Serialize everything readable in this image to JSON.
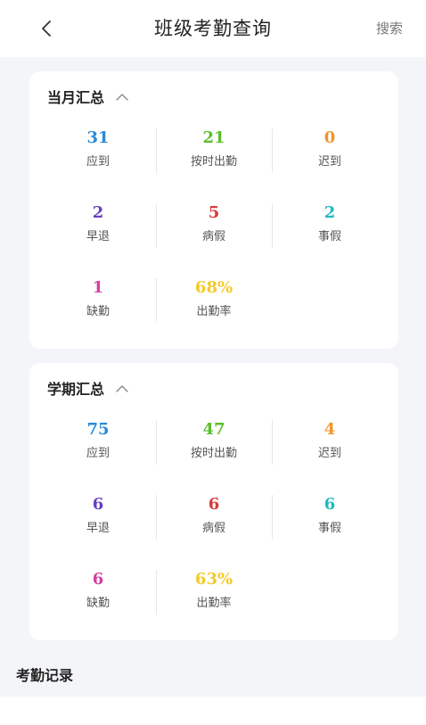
{
  "nav": {
    "title": "班级考勤查询",
    "search_label": "搜索"
  },
  "colors": {
    "blue": "#2a8ad9",
    "green": "#5bbe2a",
    "orange": "#f0962d",
    "purple": "#6a3fbf",
    "red": "#d93a3a",
    "cyan": "#22b8c0",
    "magenta": "#d33fa2",
    "yellow": "#f4c92b"
  },
  "monthly": {
    "title": "当月汇总",
    "stats": [
      {
        "value": "31",
        "label": "应到",
        "color": "#2a8ad9"
      },
      {
        "value": "21",
        "label": "按时出勤",
        "color": "#5bbe2a"
      },
      {
        "value": "0",
        "label": "迟到",
        "color": "#f0962d"
      },
      {
        "value": "2",
        "label": "早退",
        "color": "#6a3fbf"
      },
      {
        "value": "5",
        "label": "病假",
        "color": "#d93a3a"
      },
      {
        "value": "2",
        "label": "事假",
        "color": "#22b8c0"
      },
      {
        "value": "1",
        "label": "缺勤",
        "color": "#d33fa2"
      },
      {
        "value": "68%",
        "label": "出勤率",
        "color": "#f4c92b"
      }
    ]
  },
  "semester": {
    "title": "学期汇总",
    "stats": [
      {
        "value": "75",
        "label": "应到",
        "color": "#2a8ad9"
      },
      {
        "value": "47",
        "label": "按时出勤",
        "color": "#5bbe2a"
      },
      {
        "value": "4",
        "label": "迟到",
        "color": "#f0962d"
      },
      {
        "value": "6",
        "label": "早退",
        "color": "#6a3fbf"
      },
      {
        "value": "6",
        "label": "病假",
        "color": "#d93a3a"
      },
      {
        "value": "6",
        "label": "事假",
        "color": "#22b8c0"
      },
      {
        "value": "6",
        "label": "缺勤",
        "color": "#d33fa2"
      },
      {
        "value": "63%",
        "label": "出勤率",
        "color": "#f4c92b"
      }
    ]
  },
  "records": {
    "title": "考勤记录"
  }
}
